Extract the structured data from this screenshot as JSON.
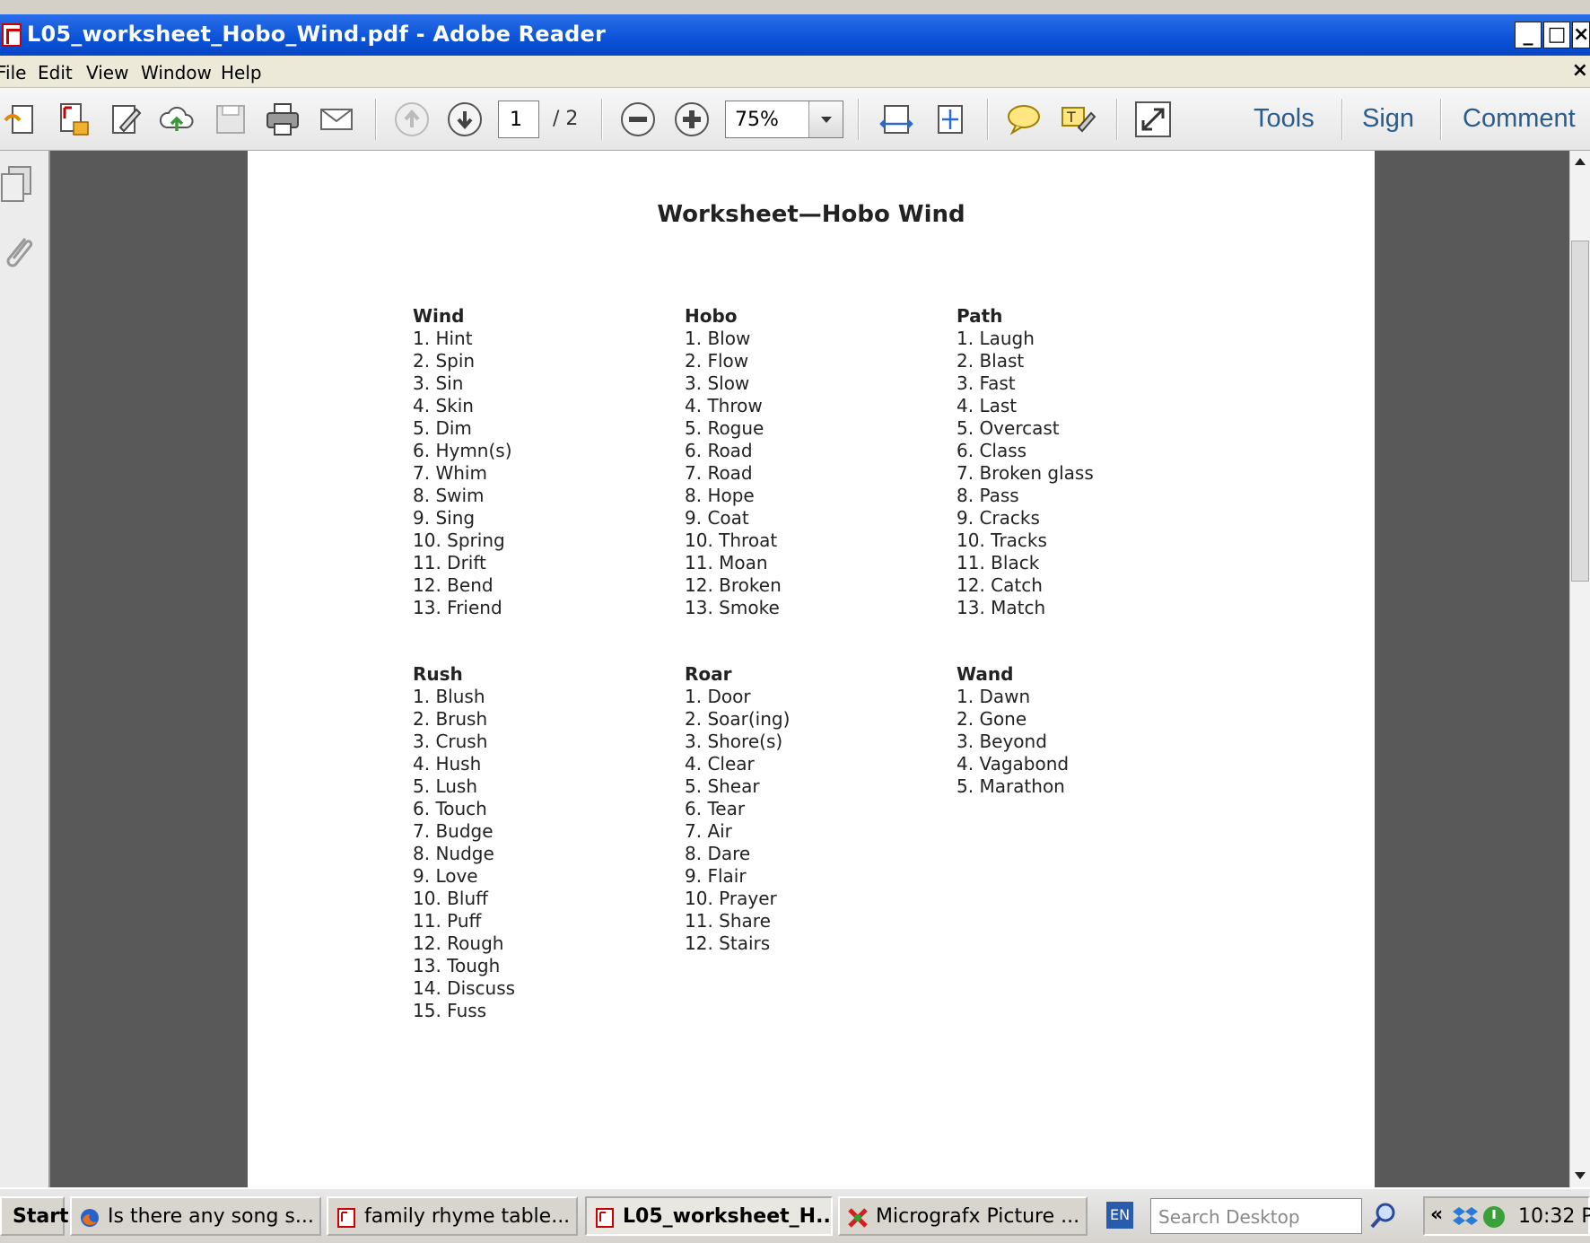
{
  "window": {
    "title": "L05_worksheet_Hobo_Wind.pdf - Adobe Reader",
    "min_glyph": "_",
    "max_glyph": "□",
    "close_glyph": "×"
  },
  "menu": {
    "items": [
      "File",
      "Edit",
      "View",
      "Window",
      "Help"
    ],
    "close_doc_glyph": "×"
  },
  "toolbar": {
    "page_current": "1",
    "page_total": "/ 2",
    "zoom": "75%",
    "tools_label": "Tools",
    "sign_label": "Sign",
    "comment_label": "Comment"
  },
  "document": {
    "title": "Worksheet—Hobo Wind",
    "groups": [
      {
        "heading": "Wind",
        "items": [
          "1. Hint",
          "2. Spin",
          "3. Sin",
          "4. Skin",
          "5. Dim",
          "6. Hymn(s)",
          "7. Whim",
          "8. Swim",
          "9. Sing",
          "10. Spring",
          "11. Drift",
          "12. Bend",
          "13. Friend"
        ]
      },
      {
        "heading": "Hobo",
        "items": [
          "1. Blow",
          "2. Flow",
          "3. Slow",
          "4. Throw",
          "5. Rogue",
          "6. Road",
          "7. Road",
          "8. Hope",
          "9. Coat",
          "10. Throat",
          "11. Moan",
          "12. Broken",
          "13. Smoke"
        ]
      },
      {
        "heading": "Path",
        "items": [
          "1. Laugh",
          "2. Blast",
          "3. Fast",
          "4. Last",
          "5. Overcast",
          "6. Class",
          "7. Broken glass",
          "8. Pass",
          "9. Cracks",
          "10. Tracks",
          "11. Black",
          "12. Catch",
          "13. Match"
        ]
      },
      {
        "heading": "Rush",
        "items": [
          "1. Blush",
          "2. Brush",
          "3. Crush",
          "4. Hush",
          "5. Lush",
          "6. Touch",
          "7. Budge",
          "8. Nudge",
          "9. Love",
          "10. Bluff",
          "11. Puff",
          "12. Rough",
          "13. Tough",
          "14. Discuss",
          "15. Fuss"
        ]
      },
      {
        "heading": "Roar",
        "items": [
          "1. Door",
          "2. Soar(ing)",
          "3. Shore(s)",
          "4. Clear",
          "5. Shear",
          "6. Tear",
          "7. Air",
          "8. Dare",
          "9. Flair",
          "10. Prayer",
          "11. Share",
          "12. Stairs"
        ]
      },
      {
        "heading": "Wand",
        "items": [
          "1. Dawn",
          "2. Gone",
          "3. Beyond",
          "4. Vagabond",
          "5. Marathon"
        ]
      }
    ]
  },
  "taskbar": {
    "start_label": "Start",
    "tasks": [
      {
        "label": "Is there any song s..."
      },
      {
        "label": "family rhyme table..."
      },
      {
        "label": "L05_worksheet_H..."
      },
      {
        "label": "Micrografx Picture ..."
      }
    ],
    "language": "EN",
    "search_placeholder": "Search Desktop",
    "tray_chevron": "«",
    "clock": "10:32 P"
  },
  "colors": {
    "titlebar": "#0a52d8",
    "doc_bg": "#595959",
    "link": "#2a5c8c"
  }
}
